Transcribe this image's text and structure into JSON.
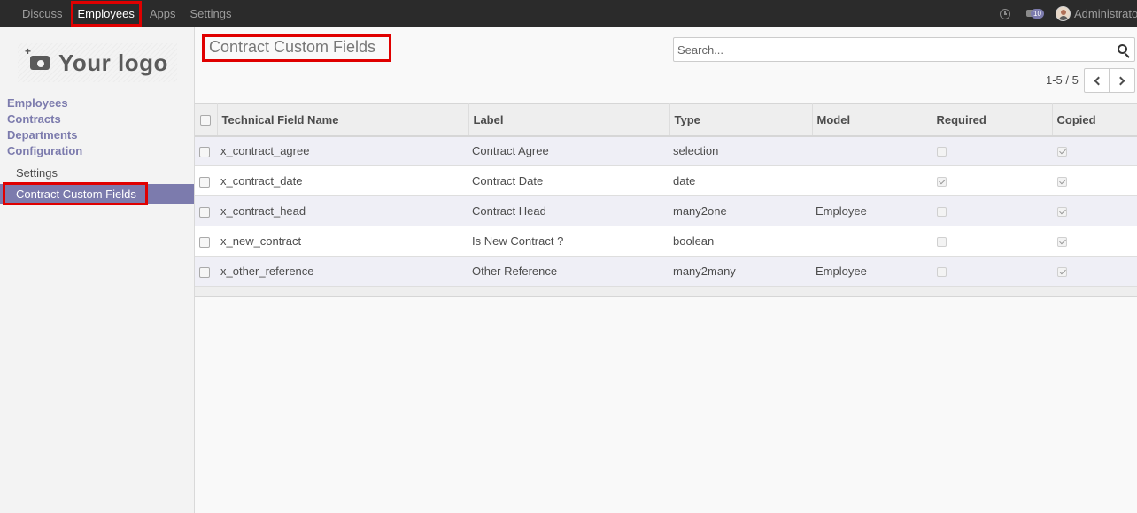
{
  "topbar": {
    "menu": [
      {
        "label": "Discuss",
        "active": false
      },
      {
        "label": "Employees",
        "active": true
      },
      {
        "label": "Apps",
        "active": false
      },
      {
        "label": "Settings",
        "active": false
      }
    ],
    "chat_badge": "10",
    "user_name": "Administrator"
  },
  "sidebar": {
    "logo_text": "Your logo",
    "sections": [
      "Employees",
      "Contracts",
      "Departments",
      "Configuration"
    ],
    "config_items": [
      "Settings",
      "Contract Custom Fields"
    ]
  },
  "control_panel": {
    "title": "Contract Custom Fields",
    "search_placeholder": "Search...",
    "pager": "1-5 / 5"
  },
  "table": {
    "columns": [
      "Technical Field Name",
      "Label",
      "Type",
      "Model",
      "Required",
      "Copied"
    ],
    "rows": [
      {
        "name": "x_contract_agree",
        "label": "Contract Agree",
        "type": "selection",
        "model": "",
        "required": false,
        "copied": true
      },
      {
        "name": "x_contract_date",
        "label": "Contract Date",
        "type": "date",
        "model": "",
        "required": true,
        "copied": true
      },
      {
        "name": "x_contract_head",
        "label": "Contract Head",
        "type": "many2one",
        "model": "Employee",
        "required": false,
        "copied": true
      },
      {
        "name": "x_new_contract",
        "label": "Is New Contract ?",
        "type": "boolean",
        "model": "",
        "required": false,
        "copied": true
      },
      {
        "name": "x_other_reference",
        "label": "Other Reference",
        "type": "many2many",
        "model": "Employee",
        "required": false,
        "copied": true
      }
    ]
  },
  "colors": {
    "accent": "#7c7bad",
    "highlight": "#e00000",
    "topbar_bg": "#2b2b2b"
  }
}
